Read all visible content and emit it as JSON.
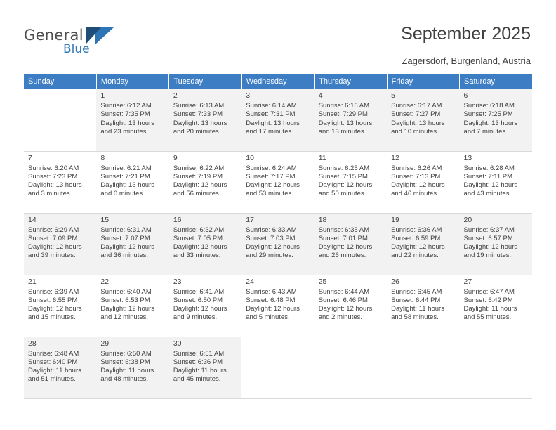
{
  "brand": {
    "name_top": "General",
    "name_bottom": "Blue",
    "flag_dark": "#1f4e79",
    "flag_light": "#2e75b6"
  },
  "header": {
    "title": "September 2025",
    "location": "Zagersdorf, Burgenland, Austria"
  },
  "theme": {
    "header_bg": "#3c7dc4",
    "header_text": "#ffffff",
    "row_shaded": "#f2f2f2",
    "text": "#3f3f3f"
  },
  "weekdays": [
    "Sunday",
    "Monday",
    "Tuesday",
    "Wednesday",
    "Thursday",
    "Friday",
    "Saturday"
  ],
  "weeks": [
    [
      {
        "day": "",
        "info": ""
      },
      {
        "day": "1",
        "info": "Sunrise: 6:12 AM\nSunset: 7:35 PM\nDaylight: 13 hours\nand 23 minutes."
      },
      {
        "day": "2",
        "info": "Sunrise: 6:13 AM\nSunset: 7:33 PM\nDaylight: 13 hours\nand 20 minutes."
      },
      {
        "day": "3",
        "info": "Sunrise: 6:14 AM\nSunset: 7:31 PM\nDaylight: 13 hours\nand 17 minutes."
      },
      {
        "day": "4",
        "info": "Sunrise: 6:16 AM\nSunset: 7:29 PM\nDaylight: 13 hours\nand 13 minutes."
      },
      {
        "day": "5",
        "info": "Sunrise: 6:17 AM\nSunset: 7:27 PM\nDaylight: 13 hours\nand 10 minutes."
      },
      {
        "day": "6",
        "info": "Sunrise: 6:18 AM\nSunset: 7:25 PM\nDaylight: 13 hours\nand 7 minutes."
      }
    ],
    [
      {
        "day": "7",
        "info": "Sunrise: 6:20 AM\nSunset: 7:23 PM\nDaylight: 13 hours\nand 3 minutes."
      },
      {
        "day": "8",
        "info": "Sunrise: 6:21 AM\nSunset: 7:21 PM\nDaylight: 13 hours\nand 0 minutes."
      },
      {
        "day": "9",
        "info": "Sunrise: 6:22 AM\nSunset: 7:19 PM\nDaylight: 12 hours\nand 56 minutes."
      },
      {
        "day": "10",
        "info": "Sunrise: 6:24 AM\nSunset: 7:17 PM\nDaylight: 12 hours\nand 53 minutes."
      },
      {
        "day": "11",
        "info": "Sunrise: 6:25 AM\nSunset: 7:15 PM\nDaylight: 12 hours\nand 50 minutes."
      },
      {
        "day": "12",
        "info": "Sunrise: 6:26 AM\nSunset: 7:13 PM\nDaylight: 12 hours\nand 46 minutes."
      },
      {
        "day": "13",
        "info": "Sunrise: 6:28 AM\nSunset: 7:11 PM\nDaylight: 12 hours\nand 43 minutes."
      }
    ],
    [
      {
        "day": "14",
        "info": "Sunrise: 6:29 AM\nSunset: 7:09 PM\nDaylight: 12 hours\nand 39 minutes."
      },
      {
        "day": "15",
        "info": "Sunrise: 6:31 AM\nSunset: 7:07 PM\nDaylight: 12 hours\nand 36 minutes."
      },
      {
        "day": "16",
        "info": "Sunrise: 6:32 AM\nSunset: 7:05 PM\nDaylight: 12 hours\nand 33 minutes."
      },
      {
        "day": "17",
        "info": "Sunrise: 6:33 AM\nSunset: 7:03 PM\nDaylight: 12 hours\nand 29 minutes."
      },
      {
        "day": "18",
        "info": "Sunrise: 6:35 AM\nSunset: 7:01 PM\nDaylight: 12 hours\nand 26 minutes."
      },
      {
        "day": "19",
        "info": "Sunrise: 6:36 AM\nSunset: 6:59 PM\nDaylight: 12 hours\nand 22 minutes."
      },
      {
        "day": "20",
        "info": "Sunrise: 6:37 AM\nSunset: 6:57 PM\nDaylight: 12 hours\nand 19 minutes."
      }
    ],
    [
      {
        "day": "21",
        "info": "Sunrise: 6:39 AM\nSunset: 6:55 PM\nDaylight: 12 hours\nand 15 minutes."
      },
      {
        "day": "22",
        "info": "Sunrise: 6:40 AM\nSunset: 6:53 PM\nDaylight: 12 hours\nand 12 minutes."
      },
      {
        "day": "23",
        "info": "Sunrise: 6:41 AM\nSunset: 6:50 PM\nDaylight: 12 hours\nand 9 minutes."
      },
      {
        "day": "24",
        "info": "Sunrise: 6:43 AM\nSunset: 6:48 PM\nDaylight: 12 hours\nand 5 minutes."
      },
      {
        "day": "25",
        "info": "Sunrise: 6:44 AM\nSunset: 6:46 PM\nDaylight: 12 hours\nand 2 minutes."
      },
      {
        "day": "26",
        "info": "Sunrise: 6:45 AM\nSunset: 6:44 PM\nDaylight: 11 hours\nand 58 minutes."
      },
      {
        "day": "27",
        "info": "Sunrise: 6:47 AM\nSunset: 6:42 PM\nDaylight: 11 hours\nand 55 minutes."
      }
    ],
    [
      {
        "day": "28",
        "info": "Sunrise: 6:48 AM\nSunset: 6:40 PM\nDaylight: 11 hours\nand 51 minutes."
      },
      {
        "day": "29",
        "info": "Sunrise: 6:50 AM\nSunset: 6:38 PM\nDaylight: 11 hours\nand 48 minutes."
      },
      {
        "day": "30",
        "info": "Sunrise: 6:51 AM\nSunset: 6:36 PM\nDaylight: 11 hours\nand 45 minutes."
      },
      {
        "day": "",
        "info": ""
      },
      {
        "day": "",
        "info": ""
      },
      {
        "day": "",
        "info": ""
      },
      {
        "day": "",
        "info": ""
      }
    ]
  ]
}
